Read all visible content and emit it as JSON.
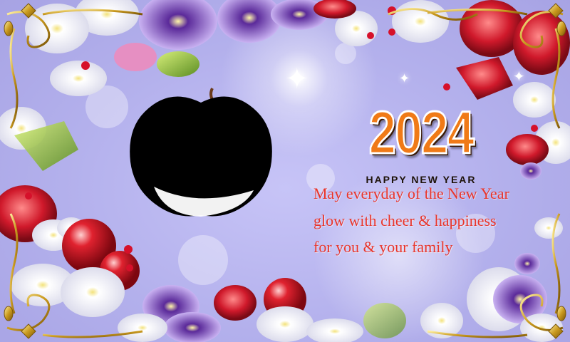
{
  "card": {
    "year": "2024",
    "subtitle": "HAPPY NEW YEAR",
    "message_lines": [
      "May everyday of  the New Year",
      "glow with cheer & happiness",
      "for you & your family"
    ]
  },
  "colors": {
    "background": "#b3b0ec",
    "year_fill": "#f07a17",
    "message": "#e8352b",
    "gold_frame": "#c9991e"
  },
  "decorations": {
    "frame": "gold-scroll-frame",
    "flowers": [
      "pansy",
      "white-rose",
      "red-carnation",
      "daisy",
      "red-cherry"
    ],
    "photo_placeholder": "apple-shaped-photo-cutout"
  }
}
